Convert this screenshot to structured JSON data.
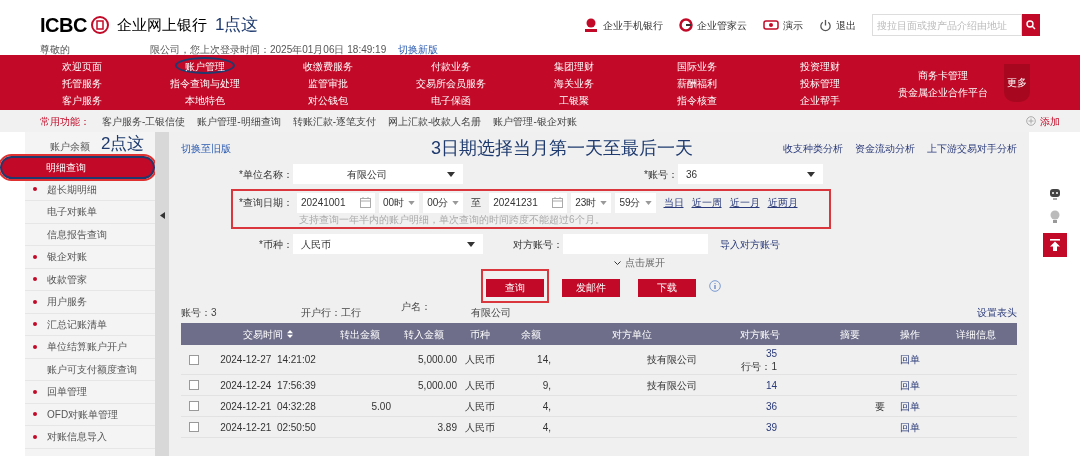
{
  "header": {
    "logo_text": "ICBC",
    "title": "企业网上银行",
    "annotation": "1点这",
    "greeting": "尊敬的",
    "login_info": "限公司，您上次登录时间：2025年01月06日 18:49:19",
    "switch_link": "切换新版",
    "tools": [
      {
        "kind": "mobile",
        "label": "企业手机银行"
      },
      {
        "kind": "cloud",
        "label": "企业管家云"
      },
      {
        "kind": "demo",
        "label": "演示"
      },
      {
        "kind": "logout",
        "label": "退出"
      }
    ],
    "search": {
      "placeholder": "搜拉目面或搜产品介绍由地址"
    }
  },
  "nav": {
    "columns": [
      [
        {
          "label": "欢迎页面",
          "circled": false
        },
        {
          "label": "托管服务",
          "circled": false
        },
        {
          "label": "客户服务",
          "circled": false
        }
      ],
      [
        {
          "label": "账户管理",
          "circled": true
        },
        {
          "label": "指令查询与处理",
          "circled": false
        },
        {
          "label": "本地特色",
          "circled": false
        }
      ],
      [
        {
          "label": "收缴费服务",
          "circled": false
        },
        {
          "label": "监管审批",
          "circled": false
        },
        {
          "label": "对公钱包",
          "circled": false
        }
      ],
      [
        {
          "label": "付款业务",
          "circled": false
        },
        {
          "label": "交易所会员服务",
          "circled": false
        },
        {
          "label": "电子保函",
          "circled": false
        }
      ],
      [
        {
          "label": "集团理财",
          "circled": false
        },
        {
          "label": "海关业务",
          "circled": false
        },
        {
          "label": "工银聚",
          "circled": false
        }
      ],
      [
        {
          "label": "国际业务",
          "circled": false
        },
        {
          "label": "薪酬福利",
          "circled": false
        },
        {
          "label": "指令核查",
          "circled": false
        }
      ],
      [
        {
          "label": "投资理财",
          "circled": false
        },
        {
          "label": "投标管理",
          "circled": false
        },
        {
          "label": "企业帮手",
          "circled": false
        }
      ],
      [
        {
          "label": "商务卡管理",
          "circled": false
        },
        {
          "label": "贵金属企业合作平台",
          "circled": false
        }
      ]
    ],
    "more": "更多"
  },
  "quick_bar": {
    "label": "常用功能：",
    "items": [
      "客户服务-工银信使",
      "账户管理-明细查询",
      "转账汇款-逐笔支付",
      "网上汇款-收款人名册",
      "账户管理-银企对账"
    ],
    "add": "添加"
  },
  "sidebar": {
    "header": "账户余额",
    "annotation": "2点这",
    "items": [
      {
        "label": "明细查询",
        "bullet": false,
        "selected": true,
        "circled": true
      },
      {
        "label": "超长期明细",
        "bullet": true,
        "selected": false,
        "circled": false
      },
      {
        "label": "电子对账单",
        "bullet": false,
        "selected": false,
        "circled": false
      },
      {
        "label": "信息报告查询",
        "bullet": false,
        "selected": false,
        "circled": false
      },
      {
        "label": "银企对账",
        "bullet": true,
        "selected": false,
        "circled": false
      },
      {
        "label": "收款管家",
        "bullet": true,
        "selected": false,
        "circled": false
      },
      {
        "label": "用户服务",
        "bullet": true,
        "selected": false,
        "circled": false
      },
      {
        "label": "汇总记账清单",
        "bullet": true,
        "selected": false,
        "circled": false
      },
      {
        "label": "单位结算账户开户",
        "bullet": true,
        "selected": false,
        "circled": false
      },
      {
        "label": "账户可支付额度查询",
        "bullet": false,
        "selected": false,
        "circled": false
      },
      {
        "label": "回单管理",
        "bullet": true,
        "selected": false,
        "circled": false
      },
      {
        "label": "OFD对账单管理",
        "bullet": true,
        "selected": false,
        "circled": false
      },
      {
        "label": "对账信息导入",
        "bullet": true,
        "selected": false,
        "circled": false
      }
    ]
  },
  "main": {
    "old_version_link": "切换至旧版",
    "annotation": "3日期选择当月第一天至最后一天",
    "analysis_links": [
      "收支种类分析",
      "资金流动分析",
      "上下游交易对手分析"
    ],
    "unit_field": {
      "label": "*单位名称：",
      "value": "有限公司"
    },
    "account_field": {
      "label": "*账号：",
      "value": "36"
    },
    "date_range": {
      "label": "*查询日期：",
      "highlighted": true,
      "start": "20241001",
      "start_hour": "00时",
      "start_minute": "00分",
      "separator": "至",
      "end": "20241231",
      "end_hour": "23时",
      "end_minute": "59分",
      "shortcuts": [
        "当日",
        "近一周",
        "近一月",
        "近两月"
      ],
      "hint": "支持查询一年半内的账户明细，单次查询的时间跨度不能超过6个月。"
    },
    "currency_field": {
      "label": "*币种：",
      "value": "人民币"
    },
    "counterparty_field": {
      "label": "对方账号："
    },
    "import_link": "导入对方账号",
    "expand": "点击展开",
    "buttons": [
      {
        "label": "查询",
        "highlighted": true
      },
      {
        "label": "发邮件",
        "highlighted": false
      },
      {
        "label": "下载",
        "highlighted": false
      }
    ],
    "info": {
      "account": "账号：3",
      "bank": "开户行：工行",
      "name_label": "户名：",
      "name_value": "有限公司",
      "settings_link": "设置表头"
    },
    "table": {
      "columns": [
        "交易时间",
        "转出金额",
        "转入金额",
        "币种",
        "余额",
        "对方单位",
        "对方账号",
        "摘要",
        "操作",
        "详细信息"
      ],
      "rows": [
        {
          "checked": false,
          "time": "2024-12-27  14:21:02",
          "out": "",
          "in": "5,000.00",
          "currency": "人民币",
          "balance": "14,",
          "party": "技有限公司",
          "account": "35",
          "bank_no": "行号：1",
          "memo": "",
          "action": "回单"
        },
        {
          "checked": false,
          "time": "2024-12-24  17:56:39",
          "out": "",
          "in": "5,000.00",
          "currency": "人民币",
          "balance": "9,",
          "party": "技有限公司",
          "account": "14",
          "memo": "",
          "action": "回单"
        },
        {
          "checked": false,
          "time": "2024-12-21  04:32:28",
          "out": "5.00",
          "in": "",
          "currency": "人民币",
          "balance": "4,",
          "party": "",
          "account": "36",
          "memo": "要",
          "action": "回单"
        },
        {
          "checked": false,
          "time": "2024-12-21  02:50:50",
          "out": "",
          "in": "3.89",
          "currency": "人民币",
          "balance": "4,",
          "party": "",
          "account": "39",
          "memo": "",
          "action": "回单"
        }
      ]
    }
  }
}
